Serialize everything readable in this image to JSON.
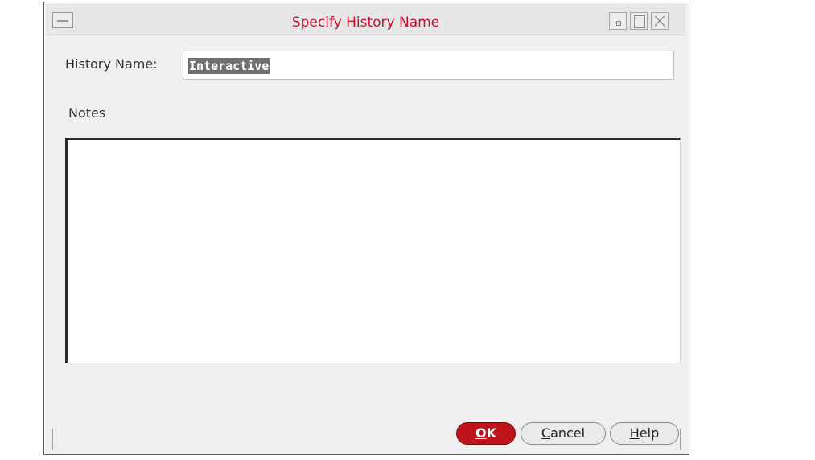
{
  "window": {
    "title": "Specify History Name"
  },
  "form": {
    "history_label": "History Name:",
    "history_value": "Interactive",
    "notes_label": "Notes",
    "notes_value": ""
  },
  "buttons": {
    "ok": {
      "mnemonic": "O",
      "rest": "K"
    },
    "cancel": {
      "mnemonic": "C",
      "rest": "ancel"
    },
    "help": {
      "mnemonic": "H",
      "rest": "elp"
    }
  },
  "icons": {
    "system_menu": "window-menu-icon",
    "minimize": "minimize-icon",
    "maximize": "maximize-icon",
    "close": "close-icon"
  },
  "colors": {
    "title_text": "#c8102e",
    "ok_button": "#c0141c",
    "window_bg": "#efefef"
  }
}
